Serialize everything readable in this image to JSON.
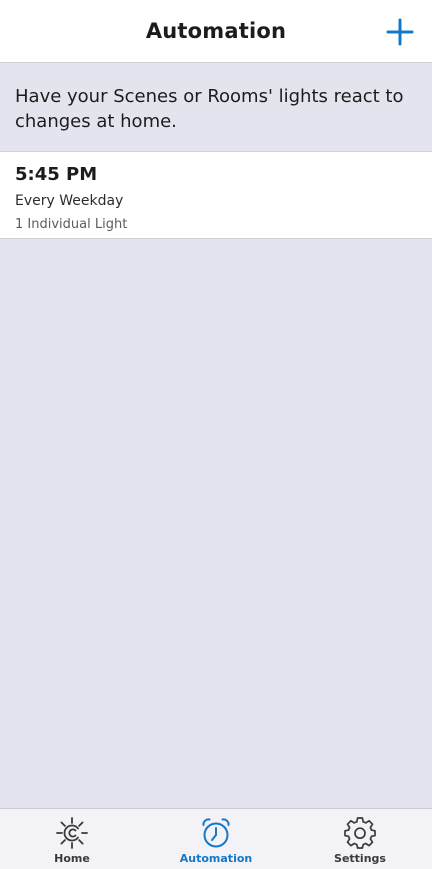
{
  "header": {
    "title": "Automation"
  },
  "description": "Have your Scenes or Rooms' lights react to changes at home.",
  "automations": [
    {
      "time": "5:45 PM",
      "schedule": "Every Weekday",
      "target": "1 Individual Light"
    }
  ],
  "tabbar": {
    "tabs": [
      {
        "label": "Home",
        "icon": "sun-logo-icon",
        "active": false
      },
      {
        "label": "Automation",
        "icon": "alarm-clock-icon",
        "active": true
      },
      {
        "label": "Settings",
        "icon": "gear-icon",
        "active": false
      }
    ]
  },
  "colors": {
    "accent": "#1478c8",
    "background": "#e4e4ee",
    "surface": "#ffffff"
  }
}
